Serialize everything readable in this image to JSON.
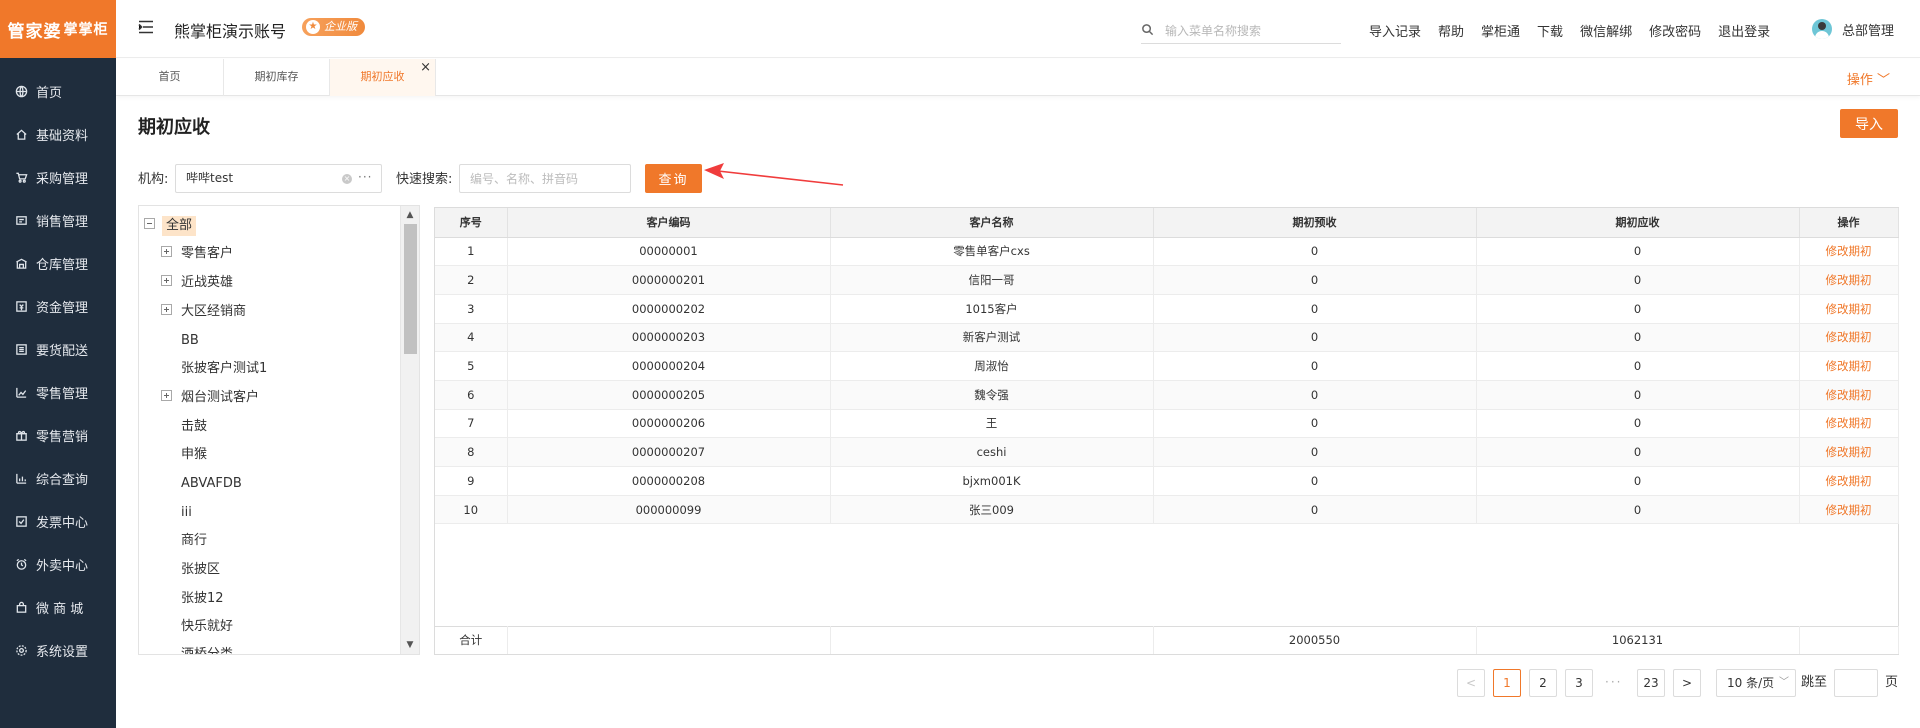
{
  "brand": {
    "logo_main": "管家婆",
    "logo_sub": "掌掌柜",
    "accent": "#f0782a",
    "sidebar_bg": "#1f2d3d"
  },
  "sidebar": {
    "items": [
      {
        "label": "首页",
        "icon": "globe-icon"
      },
      {
        "label": "基础资料",
        "icon": "home-icon"
      },
      {
        "label": "采购管理",
        "icon": "cart-icon"
      },
      {
        "label": "销售管理",
        "icon": "sales-icon"
      },
      {
        "label": "仓库管理",
        "icon": "warehouse-icon"
      },
      {
        "label": "资金管理",
        "icon": "money-icon"
      },
      {
        "label": "要货配送",
        "icon": "delivery-icon"
      },
      {
        "label": "零售管理",
        "icon": "retail-chart-icon"
      },
      {
        "label": "零售营销",
        "icon": "gift-icon"
      },
      {
        "label": "综合查询",
        "icon": "bar-chart-icon"
      },
      {
        "label": "发票中心",
        "icon": "invoice-icon"
      },
      {
        "label": "外卖中心",
        "icon": "alarm-icon"
      },
      {
        "label": "微 商 城",
        "icon": "bag-icon"
      },
      {
        "label": "系统设置",
        "icon": "gear-icon"
      }
    ]
  },
  "header": {
    "account_title": "熊掌柜演示账号",
    "badge": "企业版",
    "search_placeholder": "输入菜单名称搜索",
    "links": [
      "导入记录",
      "帮助",
      "掌柜通",
      "下载",
      "微信解绑",
      "修改密码",
      "退出登录"
    ],
    "user": "总部管理"
  },
  "tabs": {
    "items": [
      "首页",
      "期初库存",
      "期初应收"
    ],
    "close": "×",
    "ops": "操作 ﹀"
  },
  "main": {
    "title": "期初应收",
    "import_btn": "导入",
    "org_label": "机构:",
    "org_value": "哔哔test",
    "org_clear": "×",
    "org_more": "···",
    "quick_label": "快速搜索:",
    "quick_placeholder": "编号、名称、拼音码",
    "query_btn": "查询"
  },
  "tree": {
    "root": "全部",
    "nodes": [
      {
        "label": "零售客户",
        "expandable": true
      },
      {
        "label": "近战英雄",
        "expandable": true
      },
      {
        "label": "大区经销商",
        "expandable": true
      },
      {
        "label": "BB",
        "expandable": false
      },
      {
        "label": "张披客户测试1",
        "expandable": false
      },
      {
        "label": "烟台测试客户",
        "expandable": true
      },
      {
        "label": "击鼓",
        "expandable": false
      },
      {
        "label": "申猴",
        "expandable": false
      },
      {
        "label": "ABVAFDB",
        "expandable": false
      },
      {
        "label": "iii",
        "expandable": false
      },
      {
        "label": "商行",
        "expandable": false
      },
      {
        "label": "张披区",
        "expandable": false
      },
      {
        "label": "张披12",
        "expandable": false
      },
      {
        "label": "快乐就好",
        "expandable": false
      },
      {
        "label": "酒桥分类",
        "expandable": false
      }
    ]
  },
  "table": {
    "headers": [
      "序号",
      "客户编码",
      "客户名称",
      "期初预收",
      "期初应收",
      "操作"
    ],
    "rows": [
      [
        "1",
        "00000001",
        "零售单客户cxs",
        "0",
        "0",
        "修改期初"
      ],
      [
        "2",
        "0000000201",
        "信阳一哥",
        "0",
        "0",
        "修改期初"
      ],
      [
        "3",
        "0000000202",
        "1015客户",
        "0",
        "0",
        "修改期初"
      ],
      [
        "4",
        "0000000203",
        "新客户测试",
        "0",
        "0",
        "修改期初"
      ],
      [
        "5",
        "0000000204",
        "周淑怡",
        "0",
        "0",
        "修改期初"
      ],
      [
        "6",
        "0000000205",
        "魏令强",
        "0",
        "0",
        "修改期初"
      ],
      [
        "7",
        "0000000206",
        "王",
        "0",
        "0",
        "修改期初"
      ],
      [
        "8",
        "0000000207",
        "ceshi",
        "0",
        "0",
        "修改期初"
      ],
      [
        "9",
        "0000000208",
        "bjxm001K",
        "0",
        "0",
        "修改期初"
      ],
      [
        "10",
        "000000099",
        "张三009",
        "0",
        "0",
        "修改期初"
      ]
    ],
    "footer": {
      "label": "合计",
      "prepaid_total": "2000550",
      "receivable_total": "1062131"
    }
  },
  "pager": {
    "prev": "<",
    "pages": [
      "1",
      "2",
      "3"
    ],
    "dots": "···",
    "last": "23",
    "next": ">",
    "size": "10 条/页",
    "size_caret": "﹀",
    "jump_label": "跳至",
    "page_unit": "页"
  }
}
